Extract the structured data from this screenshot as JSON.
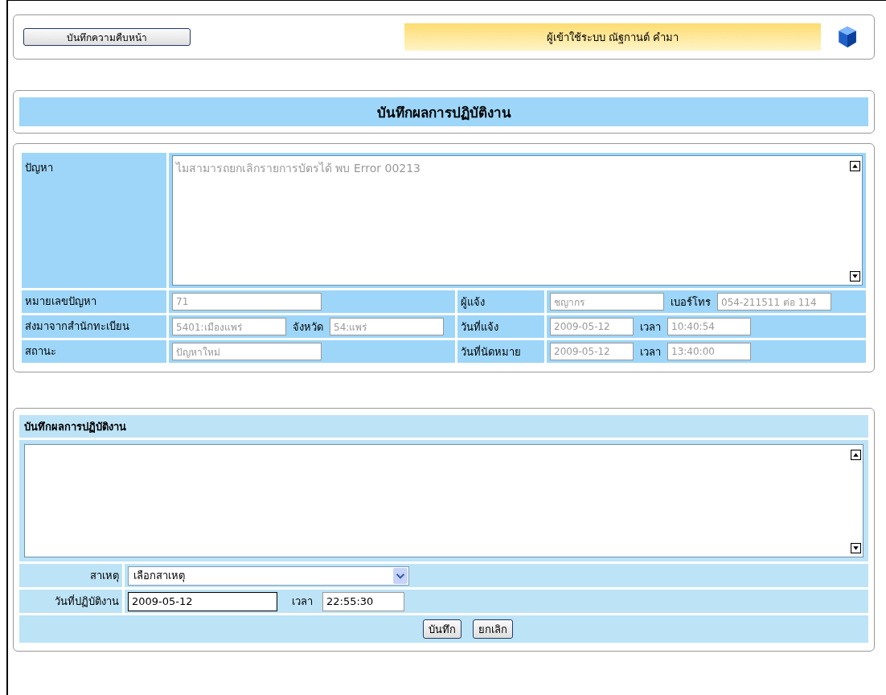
{
  "header": {
    "progress_button": "บันทึกความคืบหน้า",
    "user_label": "ผู้เข้าใช้ระบบ ณัฐกานต์ คำมา"
  },
  "title": "บันทึกผลการปฏิบัติงาน",
  "problem": {
    "label": "ปัญหา",
    "value": "ไมสามารถยกเลิกรายการบัตรได้ พบ Error 00213",
    "disabled": true
  },
  "info_rows": [
    {
      "label": "หมายเลขปัญหา",
      "fields": [
        {
          "value": "71",
          "disabled": true
        }
      ],
      "right_label": "ผู้แจ้ง",
      "right_fields": [
        {
          "value": "ชญากร",
          "disabled": true
        },
        {
          "label": "เบอร์โทร",
          "value": "054-211511 ต่อ 114",
          "disabled": true
        }
      ]
    },
    {
      "label": "ส่งมาจากสำนักทะเบียน",
      "fields": [
        {
          "value": "5401:เมืองแพร่",
          "disabled": true
        },
        {
          "label": "จังหวัด",
          "value": "54:แพร่",
          "disabled": true
        }
      ],
      "right_label": "วันที่แจ้ง",
      "right_fields": [
        {
          "value": "2009-05-12",
          "disabled": true
        },
        {
          "label": "เวลา",
          "value": "10:40:54",
          "disabled": true
        }
      ]
    },
    {
      "label": "สถานะ",
      "fields": [
        {
          "value": "ปัญหาใหม่",
          "disabled": true
        }
      ],
      "right_label": "วันที่นัดหมาย",
      "right_fields": [
        {
          "value": "2009-05-12",
          "disabled": true
        },
        {
          "label": "เวลา",
          "value": "13:40:00",
          "disabled": true
        }
      ]
    }
  ],
  "result": {
    "title": "บันทึกผลการปฏิบัติงาน",
    "cause": {
      "label": "สาเหตุ",
      "value": "เลือกสาเหตุ"
    },
    "date": {
      "label": "วันที่ปฏิบัติงาน",
      "value": "2009-05-12",
      "time_label": "เวลา",
      "time_value": "22:55:30"
    },
    "buttons": [
      "บันทึก",
      "ยกเลิก"
    ]
  }
}
